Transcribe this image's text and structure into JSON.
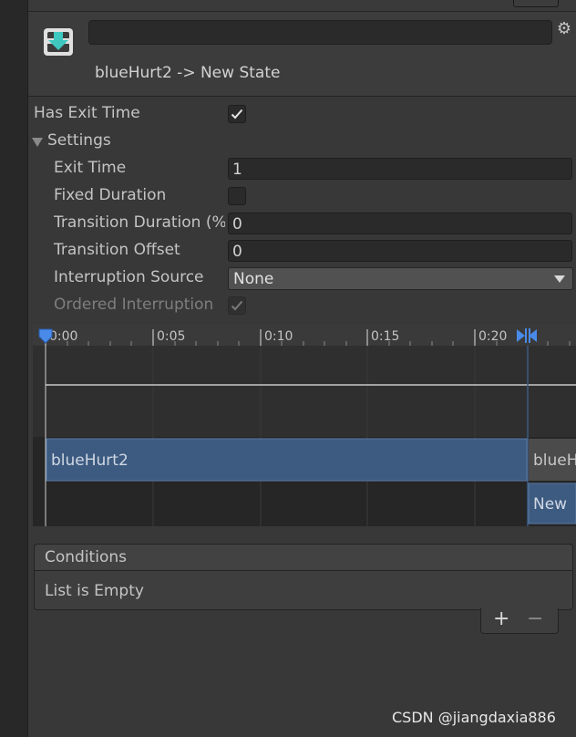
{
  "header": {
    "transition_name": "",
    "title": "blueHurt2 -> New State"
  },
  "settings": {
    "has_exit_time_label": "Has Exit Time",
    "has_exit_time": true,
    "settings_label": "Settings",
    "exit_time_label": "Exit Time",
    "exit_time_value": "1",
    "fixed_duration_label": "Fixed Duration",
    "fixed_duration": false,
    "transition_duration_label": "Transition Duration (%",
    "transition_duration_value": "0",
    "transition_offset_label": "Transition Offset",
    "transition_offset_value": "0",
    "interruption_source_label": "Interruption Source",
    "interruption_source_value": "None",
    "ordered_interruption_label": "Ordered Interruption",
    "ordered_interruption": true
  },
  "timeline": {
    "ticks": [
      "0:00",
      "0:05",
      "0:10",
      "0:15",
      "0:20"
    ],
    "source_state": "blueHurt2",
    "destination_state_partial": "blueH",
    "destination_state_lower": "New"
  },
  "conditions": {
    "header": "Conditions",
    "empty_text": "List is Empty",
    "add_symbol": "+",
    "remove_symbol": "−"
  },
  "watermark": "CSDN @jiangdaxia886",
  "colors": {
    "background": "#383838",
    "field": "#2a2a2a",
    "timeline_bar": "#3d5a80",
    "accent_blue": "#4a90e2"
  }
}
